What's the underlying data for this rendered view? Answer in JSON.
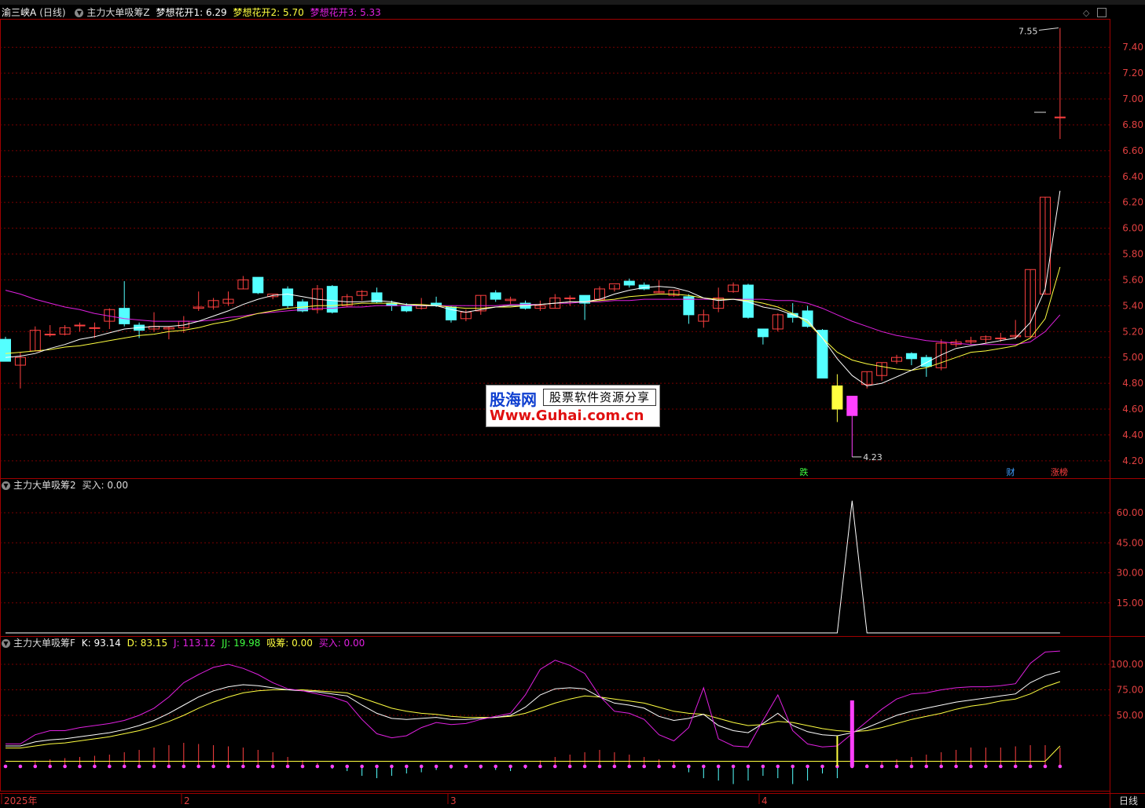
{
  "colors": {
    "up": "#ff4040",
    "down": "#54ffff",
    "ma1": "#ffffff",
    "ma2": "#ffff40",
    "ma3": "#e020e0",
    "grid": "#7a0000",
    "frame": "#a00000"
  },
  "main": {
    "title": "渝三峡A",
    "period": "(日线)",
    "indicator": "主力大单吸筹Z",
    "ma": [
      {
        "label": "梦想花开1: 6.29",
        "color": "#ffffff"
      },
      {
        "label": "梦想花开2: 5.70",
        "color": "#ffff40"
      },
      {
        "label": "梦想花开3: 5.33",
        "color": "#e020e0"
      }
    ],
    "y_ticks": [
      "7.40",
      "7.20",
      "7.00",
      "6.80",
      "6.60",
      "6.40",
      "6.20",
      "6.00",
      "5.80",
      "5.60",
      "5.40",
      "5.20",
      "5.00",
      "4.80",
      "4.60",
      "4.40",
      "4.20"
    ],
    "high_label": "7.55",
    "low_label": "4.23",
    "markers": [
      {
        "text": "跌",
        "color": "#40ff40"
      },
      {
        "text": "财",
        "color": "#40a0ff"
      },
      {
        "text": "涨榜",
        "color": "#ff4040"
      }
    ]
  },
  "panel2": {
    "indicator": "主力大单吸筹2",
    "value_label": "买入: 0.00",
    "y_ticks": [
      "60.00",
      "45.00",
      "30.00",
      "15.00"
    ]
  },
  "panel3": {
    "indicator": "主力大单吸筹F",
    "values": [
      {
        "label": "K: 93.14",
        "color": "#ffffff"
      },
      {
        "label": "D: 83.15",
        "color": "#ffff40"
      },
      {
        "label": "J: 113.12",
        "color": "#e020e0"
      },
      {
        "label": "JJ: 19.98",
        "color": "#40ff40"
      },
      {
        "label": "吸筹: 0.00",
        "color": "#ffff40"
      },
      {
        "label": "买入: 0.00",
        "color": "#e020e0"
      }
    ],
    "y_ticks": [
      "100.00",
      "75.00",
      "50.00"
    ]
  },
  "x_axis": {
    "labels": [
      "2025年",
      "2",
      "3",
      "4"
    ],
    "period_button": "日线"
  },
  "watermark": {
    "logo": "股海网",
    "slogan": "股票软件资源分享",
    "url": "Www.Guhai.com.cn"
  },
  "chart_data": {
    "type": "candlestick",
    "candles": [
      [
        5.14,
        4.97,
        5.16,
        4.97
      ],
      [
        4.94,
        5.0,
        5.04,
        4.76
      ],
      [
        5.05,
        5.21,
        5.24,
        5.05
      ],
      [
        5.18,
        5.18,
        5.25,
        5.16
      ],
      [
        5.18,
        5.23,
        5.25,
        5.17
      ],
      [
        5.25,
        5.25,
        5.27,
        5.2
      ],
      [
        5.23,
        5.23,
        5.27,
        5.15
      ],
      [
        5.28,
        5.37,
        5.38,
        5.22
      ],
      [
        5.38,
        5.26,
        5.59,
        5.24
      ],
      [
        5.25,
        5.21,
        5.27,
        5.15
      ],
      [
        5.22,
        5.24,
        5.35,
        5.2
      ],
      [
        5.22,
        5.23,
        5.24,
        5.14
      ],
      [
        5.23,
        5.28,
        5.32,
        5.19
      ],
      [
        5.38,
        5.39,
        5.51,
        5.36
      ],
      [
        5.39,
        5.44,
        5.46,
        5.37
      ],
      [
        5.42,
        5.45,
        5.51,
        5.4
      ],
      [
        5.53,
        5.6,
        5.63,
        5.53
      ],
      [
        5.62,
        5.5,
        5.62,
        5.49
      ],
      [
        5.47,
        5.49,
        5.49,
        5.45
      ],
      [
        5.53,
        5.4,
        5.55,
        5.38
      ],
      [
        5.43,
        5.36,
        5.45,
        5.35
      ],
      [
        5.37,
        5.53,
        5.56,
        5.34
      ],
      [
        5.55,
        5.35,
        5.56,
        5.34
      ],
      [
        5.4,
        5.47,
        5.49,
        5.39
      ],
      [
        5.48,
        5.51,
        5.52,
        5.44
      ],
      [
        5.5,
        5.43,
        5.54,
        5.42
      ],
      [
        5.42,
        5.4,
        5.44,
        5.36
      ],
      [
        5.4,
        5.36,
        5.42,
        5.35
      ],
      [
        5.38,
        5.4,
        5.46,
        5.37
      ],
      [
        5.42,
        5.4,
        5.47,
        5.39
      ],
      [
        5.39,
        5.29,
        5.4,
        5.27
      ],
      [
        5.3,
        5.35,
        5.37,
        5.28
      ],
      [
        5.36,
        5.48,
        5.48,
        5.33
      ],
      [
        5.5,
        5.45,
        5.52,
        5.43
      ],
      [
        5.44,
        5.45,
        5.47,
        5.41
      ],
      [
        5.42,
        5.38,
        5.44,
        5.37
      ],
      [
        5.38,
        5.4,
        5.44,
        5.36
      ],
      [
        5.38,
        5.46,
        5.49,
        5.38
      ],
      [
        5.46,
        5.46,
        5.48,
        5.4
      ],
      [
        5.48,
        5.42,
        5.47,
        5.29
      ],
      [
        5.45,
        5.53,
        5.55,
        5.44
      ],
      [
        5.53,
        5.57,
        5.56,
        5.51
      ],
      [
        5.59,
        5.56,
        5.61,
        5.54
      ],
      [
        5.56,
        5.53,
        5.58,
        5.52
      ],
      [
        5.5,
        5.51,
        5.6,
        5.5
      ],
      [
        5.48,
        5.52,
        5.52,
        5.47
      ],
      [
        5.47,
        5.33,
        5.49,
        5.26
      ],
      [
        5.28,
        5.33,
        5.37,
        5.23
      ],
      [
        5.38,
        5.46,
        5.54,
        5.35
      ],
      [
        5.51,
        5.56,
        5.58,
        5.5
      ],
      [
        5.56,
        5.31,
        5.57,
        5.3
      ],
      [
        5.22,
        5.16,
        5.22,
        5.1
      ],
      [
        5.22,
        5.33,
        5.34,
        5.2
      ],
      [
        5.34,
        5.31,
        5.42,
        5.27
      ],
      [
        5.36,
        5.24,
        5.4,
        5.23
      ],
      [
        5.21,
        4.84,
        5.22,
        4.84
      ],
      [
        4.78,
        4.6,
        4.87,
        4.5
      ],
      [
        4.55,
        4.7,
        4.7,
        4.23
      ],
      [
        4.79,
        4.89,
        4.89,
        4.76
      ],
      [
        4.86,
        4.96,
        4.96,
        4.82
      ],
      [
        4.97,
        5.0,
        5.02,
        4.95
      ],
      [
        5.03,
        4.99,
        5.04,
        4.94
      ],
      [
        5.0,
        4.93,
        5.02,
        4.85
      ],
      [
        4.92,
        5.11,
        5.14,
        4.9
      ],
      [
        5.1,
        5.12,
        5.14,
        5.08
      ],
      [
        5.12,
        5.13,
        5.16,
        5.1
      ],
      [
        5.14,
        5.16,
        5.17,
        5.11
      ],
      [
        5.15,
        5.15,
        5.19,
        5.12
      ],
      [
        5.16,
        5.17,
        5.29,
        5.14
      ],
      [
        5.16,
        5.68,
        5.68,
        5.16
      ],
      [
        5.49,
        6.24,
        6.24,
        5.49
      ],
      [
        6.86,
        6.86,
        7.55,
        6.69
      ]
    ],
    "ma1": [
      5.0,
      5.01,
      5.03,
      5.07,
      5.1,
      5.14,
      5.16,
      5.19,
      5.22,
      5.23,
      5.24,
      5.24,
      5.25,
      5.28,
      5.32,
      5.36,
      5.41,
      5.45,
      5.48,
      5.49,
      5.47,
      5.45,
      5.44,
      5.43,
      5.43,
      5.44,
      5.43,
      5.41,
      5.4,
      5.4,
      5.37,
      5.35,
      5.37,
      5.39,
      5.4,
      5.4,
      5.41,
      5.42,
      5.43,
      5.43,
      5.45,
      5.49,
      5.52,
      5.54,
      5.55,
      5.54,
      5.51,
      5.46,
      5.44,
      5.45,
      5.43,
      5.39,
      5.37,
      5.33,
      5.29,
      5.15,
      4.99,
      4.86,
      4.78,
      4.8,
      4.85,
      4.9,
      4.96,
      5.02,
      5.07,
      5.09,
      5.11,
      5.13,
      5.15,
      5.27,
      5.53,
      6.29
    ],
    "ma2": [
      5.03,
      5.04,
      5.05,
      5.06,
      5.08,
      5.09,
      5.11,
      5.13,
      5.15,
      5.17,
      5.18,
      5.2,
      5.21,
      5.23,
      5.26,
      5.28,
      5.31,
      5.34,
      5.36,
      5.38,
      5.39,
      5.4,
      5.4,
      5.41,
      5.42,
      5.42,
      5.42,
      5.41,
      5.41,
      5.4,
      5.39,
      5.38,
      5.38,
      5.39,
      5.39,
      5.4,
      5.41,
      5.42,
      5.43,
      5.43,
      5.44,
      5.45,
      5.47,
      5.48,
      5.49,
      5.49,
      5.48,
      5.46,
      5.45,
      5.45,
      5.44,
      5.42,
      5.39,
      5.34,
      5.27,
      5.15,
      5.04,
      4.98,
      4.95,
      4.93,
      4.91,
      4.9,
      4.92,
      4.96,
      5.0,
      5.04,
      5.05,
      5.07,
      5.09,
      5.15,
      5.3,
      5.7
    ],
    "ma3": [
      5.52,
      5.49,
      5.45,
      5.42,
      5.39,
      5.37,
      5.34,
      5.32,
      5.3,
      5.29,
      5.28,
      5.28,
      5.28,
      5.28,
      5.29,
      5.31,
      5.32,
      5.34,
      5.35,
      5.36,
      5.37,
      5.38,
      5.38,
      5.39,
      5.39,
      5.4,
      5.4,
      5.4,
      5.4,
      5.4,
      5.4,
      5.4,
      5.4,
      5.4,
      5.41,
      5.41,
      5.41,
      5.42,
      5.42,
      5.43,
      5.43,
      5.44,
      5.44,
      5.45,
      5.45,
      5.45,
      5.45,
      5.45,
      5.45,
      5.45,
      5.45,
      5.45,
      5.44,
      5.44,
      5.42,
      5.38,
      5.33,
      5.28,
      5.24,
      5.2,
      5.17,
      5.15,
      5.13,
      5.12,
      5.11,
      5.1,
      5.1,
      5.1,
      5.1,
      5.12,
      5.2,
      5.33
    ],
    "buy2": [
      0,
      0,
      0,
      0,
      0,
      0,
      0,
      0,
      0,
      0,
      0,
      0,
      0,
      0,
      0,
      0,
      0,
      0,
      0,
      0,
      0,
      0,
      0,
      0,
      0,
      0,
      0,
      0,
      0,
      0,
      0,
      0,
      0,
      0,
      0,
      0,
      0,
      0,
      0,
      0,
      0,
      0,
      0,
      0,
      0,
      0,
      0,
      0,
      0,
      0,
      0,
      0,
      0,
      0,
      0,
      0,
      0,
      66,
      0,
      0,
      0,
      0,
      0,
      0,
      0,
      0,
      0,
      0,
      0,
      0,
      0,
      0
    ],
    "k": [
      20,
      20,
      24,
      26,
      27,
      29,
      31,
      33,
      36,
      40,
      45,
      52,
      60,
      68,
      74,
      78,
      80,
      79,
      77,
      75,
      74,
      73,
      71,
      69,
      60,
      52,
      47,
      46,
      47,
      48,
      46,
      46,
      47,
      48,
      50,
      58,
      70,
      76,
      77,
      76,
      68,
      62,
      60,
      57,
      49,
      45,
      47,
      51,
      40,
      35,
      33,
      42,
      52,
      40,
      34,
      31,
      30,
      33,
      38,
      44,
      50,
      54,
      57,
      60,
      63,
      65,
      67,
      69,
      71,
      82,
      89,
      93
    ],
    "d": [
      18,
      18,
      20,
      22,
      23,
      25,
      27,
      29,
      32,
      35,
      39,
      44,
      50,
      57,
      63,
      68,
      72,
      74,
      75,
      75,
      75,
      74,
      73,
      72,
      67,
      62,
      57,
      54,
      52,
      51,
      49,
      48,
      48,
      48,
      49,
      52,
      57,
      62,
      66,
      69,
      68,
      66,
      64,
      62,
      58,
      54,
      52,
      51,
      47,
      43,
      40,
      41,
      44,
      43,
      40,
      37,
      35,
      34,
      35,
      38,
      42,
      46,
      49,
      52,
      56,
      59,
      61,
      64,
      66,
      71,
      78,
      83
    ],
    "j": [
      22,
      22,
      31,
      35,
      35,
      38,
      40,
      42,
      45,
      50,
      57,
      68,
      82,
      90,
      97,
      100,
      96,
      90,
      82,
      76,
      74,
      71,
      68,
      63,
      46,
      32,
      28,
      30,
      38,
      43,
      41,
      42,
      46,
      49,
      52,
      70,
      95,
      104,
      99,
      91,
      69,
      54,
      52,
      46,
      31,
      25,
      38,
      77,
      27,
      20,
      19,
      45,
      70,
      35,
      22,
      19,
      20,
      32,
      44,
      56,
      66,
      71,
      72,
      75,
      77,
      78,
      78,
      79,
      81,
      101,
      112,
      113
    ],
    "jj": [
      5,
      5,
      5,
      5,
      5,
      5,
      5,
      5,
      5,
      5,
      5,
      5,
      5,
      5,
      5,
      5,
      5,
      5,
      5,
      5,
      5,
      5,
      5,
      5,
      5,
      5,
      5,
      5,
      5,
      5,
      5,
      5,
      5,
      5,
      5,
      5,
      5,
      5,
      5,
      5,
      5,
      5,
      5,
      5,
      5,
      5,
      5,
      5,
      5,
      5,
      5,
      5,
      5,
      5,
      5,
      5,
      5,
      5,
      5,
      5,
      5,
      5,
      5,
      5,
      5,
      5,
      5,
      5,
      5,
      5,
      5,
      20
    ],
    "xichou": [
      0,
      0,
      0,
      0,
      0,
      0,
      0,
      0,
      0,
      0,
      0,
      0,
      0,
      0,
      0,
      0,
      0,
      0,
      0,
      0,
      0,
      0,
      0,
      0,
      0,
      0,
      0,
      0,
      0,
      0,
      0,
      0,
      0,
      0,
      0,
      0,
      0,
      0,
      0,
      0,
      0,
      0,
      0,
      0,
      0,
      0,
      0,
      0,
      0,
      0,
      0,
      0,
      0,
      0,
      0,
      0,
      30,
      0,
      0,
      0,
      0,
      0,
      0,
      0,
      0,
      0,
      0,
      0,
      0,
      0,
      0,
      0
    ],
    "buy3": [
      0,
      0,
      0,
      0,
      0,
      0,
      0,
      0,
      0,
      0,
      0,
      0,
      0,
      0,
      0,
      0,
      0,
      0,
      0,
      0,
      0,
      0,
      0,
      0,
      0,
      0,
      0,
      0,
      0,
      0,
      0,
      0,
      0,
      0,
      0,
      0,
      0,
      0,
      0,
      0,
      0,
      0,
      0,
      0,
      0,
      0,
      0,
      0,
      0,
      0,
      0,
      0,
      0,
      0,
      0,
      0,
      0,
      70,
      0,
      0,
      0,
      0,
      0,
      0,
      0,
      0,
      0,
      0,
      0,
      0,
      0,
      0
    ],
    "stick": [
      0,
      0,
      5,
      6,
      7,
      8,
      9,
      10,
      12,
      14,
      16,
      18,
      20,
      19,
      18,
      17,
      16,
      14,
      12,
      8,
      5,
      3,
      -2,
      -4,
      -8,
      -10,
      -8,
      -6,
      -5,
      -3,
      -2,
      -1,
      -2,
      -3,
      -4,
      -2,
      5,
      8,
      10,
      12,
      14,
      12,
      10,
      8,
      6,
      4,
      -5,
      -10,
      -12,
      -15,
      -12,
      -8,
      -10,
      -15,
      -12,
      -6,
      -10,
      0,
      2,
      4,
      6,
      8,
      10,
      12,
      14,
      16,
      16,
      16,
      17,
      18,
      18,
      16
    ],
    "y_min": 4.12,
    "y_max": 7.62
  }
}
